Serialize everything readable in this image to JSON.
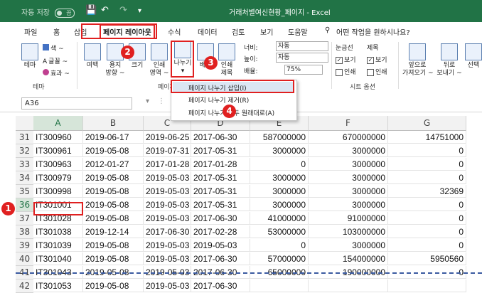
{
  "titlebar": {
    "autosave": "자동 저장",
    "toggle": "끔",
    "title": "거래처별여신현황_페이지 - Excel"
  },
  "tabs": [
    {
      "label": "파일"
    },
    {
      "label": "홈"
    },
    {
      "label": "삽입"
    },
    {
      "label": "페이지 레이아웃"
    },
    {
      "label": "수식"
    },
    {
      "label": "데이터"
    },
    {
      "label": "검토"
    },
    {
      "label": "보기"
    },
    {
      "label": "도움말"
    },
    {
      "label": "어떤 작업을 원하시나요?"
    }
  ],
  "ribbon": {
    "theme": {
      "label": "테마",
      "colors": "색 ~",
      "fonts": "글꼴 ~",
      "effects": "효과 ~",
      "group": "테마"
    },
    "margins": "여백",
    "orientation": "용지\n방향 ~",
    "size": "크기",
    "print_area": "인쇄\n영역 ~",
    "breaks": "나누기",
    "background": "배경",
    "print_titles": "인쇄\n제목",
    "width_label": "너비:",
    "width_value": "자동",
    "height_label": "높이:",
    "height_value": "자동",
    "scale_label": "배율:",
    "scale_value": "75%",
    "page_setup_group": "페이지 설정",
    "gridlines": "눈금선",
    "headings": "제목",
    "view": "보기",
    "print": "인쇄",
    "sheet_options_group": "시트 옵션",
    "bring_forward": "앞으로\n가져오기 ~",
    "send_backward": "뒤로\n보내기 ~",
    "selection": "선택"
  },
  "namebox": "A36",
  "menu": {
    "insert": "페이지 나누기 삽입(I)",
    "remove": "페이지 나누기 제거(R)",
    "reset": "페이지 나누기 모두 원래대로(A)"
  },
  "badges": [
    "1",
    "2",
    "3",
    "4"
  ],
  "columns": [
    "A",
    "B",
    "C",
    "D",
    "E",
    "F",
    "G"
  ],
  "rows": [
    {
      "n": "31",
      "a": "IT300960",
      "b": "2019-06-17",
      "c": "2019-06-25",
      "d": "2017-06-30",
      "e": "587000000",
      "f": "670000000",
      "g": "14751000"
    },
    {
      "n": "32",
      "a": "IT300961",
      "b": "2019-05-08",
      "c": "2019-07-31",
      "d": "2017-05-31",
      "e": "3000000",
      "f": "3000000",
      "g": "0"
    },
    {
      "n": "33",
      "a": "IT300963",
      "b": "2012-01-27",
      "c": "2017-01-28",
      "d": "2017-01-28",
      "e": "0",
      "f": "3000000",
      "g": "0"
    },
    {
      "n": "34",
      "a": "IT300979",
      "b": "2019-05-08",
      "c": "2019-05-03",
      "d": "2017-05-31",
      "e": "3000000",
      "f": "3000000",
      "g": "0"
    },
    {
      "n": "35",
      "a": "IT300998",
      "b": "2019-05-08",
      "c": "2019-05-03",
      "d": "2017-05-31",
      "e": "3000000",
      "f": "3000000",
      "g": "32369"
    },
    {
      "n": "36",
      "a": "IT301001",
      "b": "2019-05-08",
      "c": "2019-05-03",
      "d": "2017-05-31",
      "e": "3000000",
      "f": "3000000",
      "g": "0"
    },
    {
      "n": "37",
      "a": "IT301028",
      "b": "2019-05-08",
      "c": "2019-05-03",
      "d": "2017-06-30",
      "e": "41000000",
      "f": "91000000",
      "g": "0"
    },
    {
      "n": "38",
      "a": "IT301038",
      "b": "2019-12-14",
      "c": "2017-06-30",
      "d": "2017-02-28",
      "e": "53000000",
      "f": "103000000",
      "g": "0"
    },
    {
      "n": "39",
      "a": "IT301039",
      "b": "2019-05-08",
      "c": "2019-05-03",
      "d": "2019-05-03",
      "e": "0",
      "f": "3000000",
      "g": "0"
    },
    {
      "n": "40",
      "a": "IT301040",
      "b": "2019-05-08",
      "c": "2019-05-03",
      "d": "2017-06-30",
      "e": "57000000",
      "f": "154000000",
      "g": "5950560"
    },
    {
      "n": "41",
      "a": "IT301043",
      "b": "2019-05-08",
      "c": "2019-05-03",
      "d": "2017-06-30",
      "e": "65000000",
      "f": "190000000",
      "g": "0"
    },
    {
      "n": "42",
      "a": "IT301053",
      "b": "2019-05-08",
      "c": "2019-05-03",
      "d": "2017-06-30",
      "e": "",
      "f": "",
      "g": ""
    }
  ]
}
